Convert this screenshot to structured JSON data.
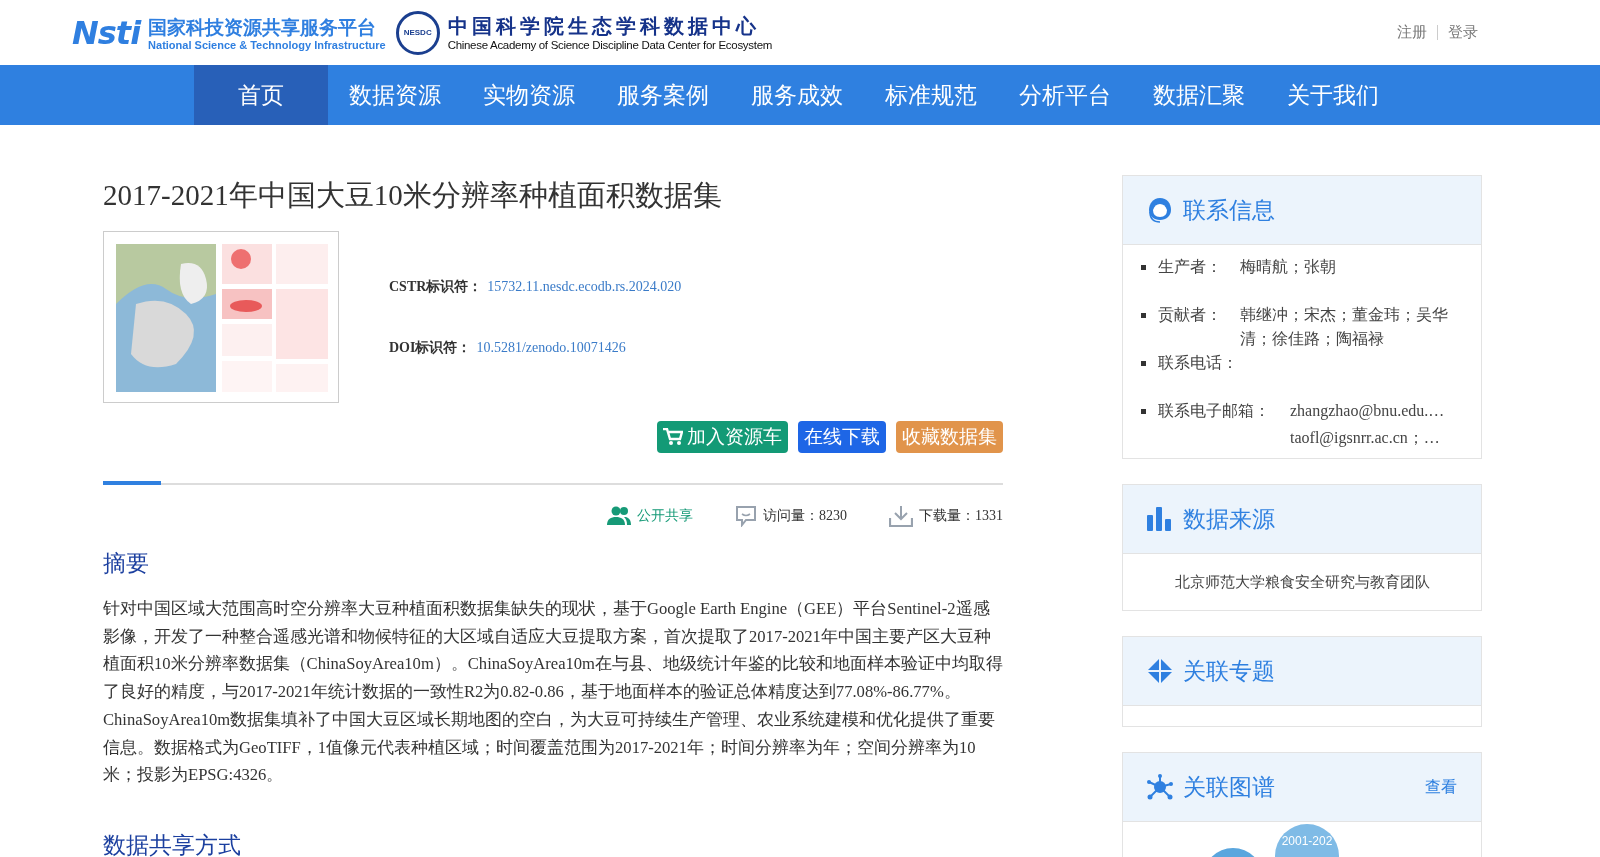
{
  "header": {
    "logo_text": "Nsti",
    "platform_name": "国家科技资源共享服务平台",
    "platform_name_en": "National Science & Technology Infrastructure",
    "center_badge": "NESDC",
    "center_name": "中国科学院生态学科数据中心",
    "center_name_en": "Chinese Academy of Science Discipline Data Center for Ecosystem",
    "links": [
      "注册",
      "登录"
    ]
  },
  "nav": [
    {
      "label": "首页",
      "selected": true
    },
    {
      "label": "数据资源",
      "selected": false
    },
    {
      "label": "实物资源",
      "selected": false
    },
    {
      "label": "服务案例",
      "selected": false
    },
    {
      "label": "服务成效",
      "selected": false
    },
    {
      "label": "标准规范",
      "selected": false
    },
    {
      "label": "分析平台",
      "selected": false
    },
    {
      "label": "数据汇聚",
      "selected": false
    },
    {
      "label": "关于我们",
      "selected": false
    }
  ],
  "dataset": {
    "title": "2017-2021年中国大豆10米分辨率种植面积数据集",
    "identifiers": [
      {
        "label": "CSTR标识符：",
        "value": "15732.11.nesdc.ecodb.rs.2024.020"
      },
      {
        "label": "DOI标识符：",
        "value": "10.5281/zenodo.10071426"
      }
    ],
    "actions": [
      {
        "label": "加入资源车",
        "kind": "cart"
      },
      {
        "label": "在线下载",
        "kind": "download"
      },
      {
        "label": "收藏数据集",
        "kind": "favorite"
      }
    ],
    "stats": [
      {
        "kind": "share",
        "text": "公开共享"
      },
      {
        "kind": "visits",
        "text": "访问量：8230"
      },
      {
        "kind": "downloads",
        "text": "下载量：1331"
      }
    ],
    "sections": [
      {
        "heading": "摘要",
        "text": "针对中国区域大范围高时空分辨率大豆种植面积数据集缺失的现状，基于Google Earth Engine（GEE）平台Sentinel-2遥感影像，开发了一种整合遥感光谱和物候特征的大区域自适应大豆提取方案，首次提取了2017-2021年中国主要产区大豆种植面积10米分辨率数据集（ChinaSoyArea10m）。ChinaSoyArea10m在与县、地级统计年鉴的比较和地面样本验证中均取得了良好的精度，与2017-2021年统计数据的一致性R2为0.82-0.86，基于地面样本的验证总体精度达到77.08%-86.77%。ChinaSoyArea10m数据集填补了中国大豆区域长期地图的空白，为大豆可持续生产管理、农业系统建模和优化提供了重要信息。数据格式为GeoTIFF，1值像元代表种植区域；时间覆盖范围为2017-2021年；时间分辨率为年；空间分辨率为10米；投影为EPSG:4326。"
      },
      {
        "heading": "数据共享方式"
      }
    ]
  },
  "sidebar": [
    {
      "kind": "contact",
      "title": "联系信息",
      "rows": [
        {
          "label": "生产者：",
          "values": [
            "梅晴航；张朝"
          ]
        },
        {
          "label": "贡献者：",
          "values": [
            "韩继冲；宋杰；董金玮；吴华清；徐佳路；陶福禄"
          ]
        },
        {
          "label": "联系电话："
        },
        {
          "label": "联系电子邮箱：",
          "values": [
            "zhangzhao@bnu.edu.…",
            "taofl@igsnrr.ac.cn；…"
          ]
        }
      ]
    },
    {
      "kind": "source",
      "title": "数据来源",
      "text": "北京师范大学粮食安全研究与教育团队"
    },
    {
      "kind": "topic",
      "title": "关联专题"
    },
    {
      "kind": "graph",
      "title": "关联图谱",
      "link": "查看",
      "bubbles": [
        "2001-202"
      ]
    }
  ]
}
